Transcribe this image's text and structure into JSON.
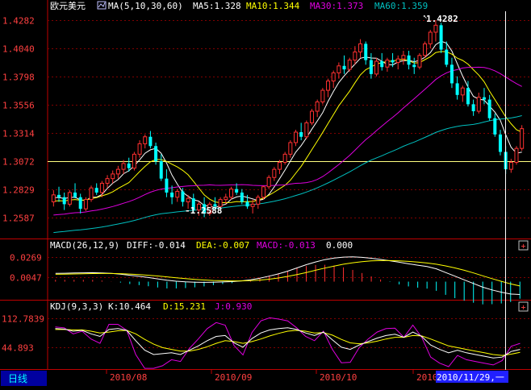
{
  "colors": {
    "background": "#000000",
    "frame": "#c00000",
    "grid": "#800000",
    "text_white": "#ffffff",
    "up_candle": "#ff3030",
    "down_candle": "#00ffff",
    "ma5": "#ffffff",
    "ma10": "#ffff00",
    "ma30": "#e000e0",
    "ma60": "#00c0c0",
    "diff": "#ffffff",
    "dea": "#ffff00",
    "macd_pos": "#ff3030",
    "macd_neg": "#00ffff",
    "k": "#ffffff",
    "d": "#ffff00",
    "j": "#e000e0",
    "axis_label": "#ff4040",
    "date_label": "#ff4040",
    "cursor_bg": "#2020ff",
    "period_tab_bg": "#0000a0",
    "period_tab_text": "#00ffff",
    "ref_line": "#ffff80"
  },
  "header": {
    "symbol": "欧元美元",
    "ma_params": "MA(5,10,30,60)",
    "ma5": "MA5:1.328",
    "ma10": "MA10:1.344",
    "ma30": "MA30:1.373",
    "ma60": "MA60:1.359"
  },
  "macd_header": {
    "params": "MACD(26,12,9)",
    "diff": "DIFF:-0.014",
    "dea": "DEA:-0.007",
    "macd": "MACD:-0.013",
    "zero": "0.000"
  },
  "kdj_header": {
    "params": "KDJ(9,3,3)",
    "k": "K:10.464",
    "d": "D:15.231",
    "j": "J:0.930"
  },
  "bottom": {
    "period_tab": "日线",
    "dates": [
      "2010/08",
      "2010/09",
      "2010/10",
      "2010"
    ],
    "cursor_date": "2010/11/29,一"
  },
  "annotations": {
    "high": "1.4282",
    "low": "1.2588"
  },
  "chart_data": [
    {
      "type": "candlestick",
      "panel": "price",
      "title": "欧元美元",
      "y_ticks": [
        1.4282,
        1.404,
        1.3798,
        1.3556,
        1.3314,
        1.3072,
        1.2829,
        1.2587
      ],
      "ylim": [
        1.246,
        1.436
      ],
      "reference_line": 1.3072,
      "ohlc": [
        [
          1.272,
          1.282,
          1.268,
          1.278
        ],
        [
          1.278,
          1.285,
          1.272,
          1.276
        ],
        [
          1.276,
          1.28,
          1.265,
          1.27
        ],
        [
          1.27,
          1.282,
          1.268,
          1.28
        ],
        [
          1.28,
          1.288,
          1.275,
          1.276
        ],
        [
          1.276,
          1.279,
          1.262,
          1.266
        ],
        [
          1.266,
          1.276,
          1.264,
          1.274
        ],
        [
          1.274,
          1.286,
          1.272,
          1.284
        ],
        [
          1.284,
          1.288,
          1.278,
          1.28
        ],
        [
          1.28,
          1.29,
          1.276,
          1.288
        ],
        [
          1.288,
          1.295,
          1.284,
          1.292
        ],
        [
          1.292,
          1.299,
          1.288,
          1.296
        ],
        [
          1.296,
          1.303,
          1.292,
          1.3
        ],
        [
          1.3,
          1.308,
          1.296,
          1.305
        ],
        [
          1.305,
          1.31,
          1.298,
          1.301
        ],
        [
          1.301,
          1.315,
          1.299,
          1.313
        ],
        [
          1.313,
          1.325,
          1.31,
          1.322
        ],
        [
          1.322,
          1.33,
          1.318,
          1.328
        ],
        [
          1.328,
          1.333,
          1.318,
          1.32
        ],
        [
          1.32,
          1.323,
          1.304,
          1.307
        ],
        [
          1.307,
          1.313,
          1.29,
          1.292
        ],
        [
          1.292,
          1.3,
          1.276,
          1.28
        ],
        [
          1.28,
          1.286,
          1.27,
          1.276
        ],
        [
          1.276,
          1.283,
          1.272,
          1.281
        ],
        [
          1.281,
          1.284,
          1.268,
          1.272
        ],
        [
          1.272,
          1.278,
          1.266,
          1.275
        ],
        [
          1.275,
          1.279,
          1.262,
          1.265
        ],
        [
          1.265,
          1.272,
          1.26,
          1.27
        ],
        [
          1.27,
          1.276,
          1.2588,
          1.262
        ],
        [
          1.262,
          1.272,
          1.26,
          1.27
        ],
        [
          1.27,
          1.276,
          1.266,
          1.268
        ],
        [
          1.268,
          1.276,
          1.265,
          1.274
        ],
        [
          1.274,
          1.279,
          1.27,
          1.276
        ],
        [
          1.276,
          1.285,
          1.274,
          1.283
        ],
        [
          1.283,
          1.288,
          1.278,
          1.28
        ],
        [
          1.28,
          1.283,
          1.27,
          1.272
        ],
        [
          1.272,
          1.278,
          1.266,
          1.268
        ],
        [
          1.268,
          1.274,
          1.262,
          1.27
        ],
        [
          1.27,
          1.278,
          1.266,
          1.276
        ],
        [
          1.276,
          1.286,
          1.274,
          1.285
        ],
        [
          1.285,
          1.295,
          1.283,
          1.293
        ],
        [
          1.293,
          1.302,
          1.29,
          1.3
        ],
        [
          1.3,
          1.308,
          1.296,
          1.306
        ],
        [
          1.306,
          1.315,
          1.304,
          1.313
        ],
        [
          1.313,
          1.325,
          1.31,
          1.323
        ],
        [
          1.323,
          1.334,
          1.32,
          1.332
        ],
        [
          1.332,
          1.34,
          1.325,
          1.328
        ],
        [
          1.328,
          1.342,
          1.326,
          1.34
        ],
        [
          1.34,
          1.352,
          1.338,
          1.35
        ],
        [
          1.35,
          1.36,
          1.345,
          1.358
        ],
        [
          1.358,
          1.37,
          1.356,
          1.368
        ],
        [
          1.368,
          1.378,
          1.362,
          1.376
        ],
        [
          1.376,
          1.385,
          1.37,
          1.383
        ],
        [
          1.383,
          1.392,
          1.378,
          1.389
        ],
        [
          1.389,
          1.398,
          1.382,
          1.386
        ],
        [
          1.386,
          1.396,
          1.384,
          1.394
        ],
        [
          1.394,
          1.406,
          1.39,
          1.401
        ],
        [
          1.401,
          1.412,
          1.396,
          1.408
        ],
        [
          1.408,
          1.41,
          1.39,
          1.394
        ],
        [
          1.394,
          1.4,
          1.378,
          1.382
        ],
        [
          1.382,
          1.396,
          1.38,
          1.393
        ],
        [
          1.393,
          1.4,
          1.385,
          1.388
        ],
        [
          1.388,
          1.396,
          1.384,
          1.394
        ],
        [
          1.394,
          1.4,
          1.388,
          1.392
        ],
        [
          1.392,
          1.398,
          1.386,
          1.395
        ],
        [
          1.395,
          1.402,
          1.39,
          1.398
        ],
        [
          1.398,
          1.402,
          1.386,
          1.39
        ],
        [
          1.39,
          1.396,
          1.382,
          1.388
        ],
        [
          1.388,
          1.4,
          1.386,
          1.398
        ],
        [
          1.398,
          1.41,
          1.396,
          1.408
        ],
        [
          1.408,
          1.42,
          1.404,
          1.418
        ],
        [
          1.418,
          1.4282,
          1.41,
          1.424
        ],
        [
          1.424,
          1.426,
          1.4,
          1.403
        ],
        [
          1.403,
          1.41,
          1.388,
          1.39
        ],
        [
          1.39,
          1.396,
          1.37,
          1.374
        ],
        [
          1.374,
          1.38,
          1.36,
          1.364
        ],
        [
          1.364,
          1.372,
          1.358,
          1.37
        ],
        [
          1.37,
          1.376,
          1.354,
          1.356
        ],
        [
          1.356,
          1.36,
          1.346,
          1.35
        ],
        [
          1.35,
          1.366,
          1.348,
          1.362
        ],
        [
          1.362,
          1.37,
          1.356,
          1.36
        ],
        [
          1.36,
          1.364,
          1.342,
          1.344
        ],
        [
          1.344,
          1.348,
          1.328,
          1.33
        ],
        [
          1.33,
          1.334,
          1.312,
          1.315
        ],
        [
          1.315,
          1.32,
          1.296,
          1.3
        ],
        [
          1.3,
          1.309,
          1.297,
          1.306
        ],
        [
          1.306,
          1.32,
          1.304,
          1.318
        ],
        [
          1.318,
          1.338,
          1.316,
          1.335
        ]
      ]
    },
    {
      "type": "line",
      "panel": "macd",
      "title": "MACD(26,12,9)",
      "y_ticks": [
        0.0269,
        0.0047
      ],
      "ylim": [
        -0.018,
        0.033
      ],
      "series": [
        {
          "name": "DIFF",
          "values": [
            0.009,
            0.0092,
            0.0094,
            0.0096,
            0.0098,
            0.0095,
            0.009,
            0.0082,
            0.007,
            0.0058,
            0.0045,
            0.003,
            0.0015,
            0.0005,
            -0.0002,
            -0.0006,
            -0.0008,
            -0.0006,
            -0.0003,
            0.0,
            0.0008,
            0.002,
            0.0038,
            0.006,
            0.0085,
            0.0115,
            0.015,
            0.0185,
            0.0215,
            0.024,
            0.0258,
            0.0268,
            0.027,
            0.0265,
            0.0255,
            0.0242,
            0.0228,
            0.0212,
            0.0195,
            0.018,
            0.0165,
            0.014,
            0.01,
            0.006,
            0.002,
            -0.002,
            -0.006,
            -0.009,
            -0.0115,
            -0.0135,
            -0.014
          ]
        },
        {
          "name": "DEA",
          "values": [
            0.008,
            0.0082,
            0.0084,
            0.0086,
            0.0088,
            0.0089,
            0.0089,
            0.0087,
            0.0083,
            0.0077,
            0.007,
            0.0062,
            0.0052,
            0.0042,
            0.0033,
            0.0025,
            0.0018,
            0.0013,
            0.001,
            0.0008,
            0.0008,
            0.0011,
            0.0017,
            0.0027,
            0.004,
            0.0057,
            0.0077,
            0.01,
            0.0124,
            0.0148,
            0.017,
            0.019,
            0.0206,
            0.0218,
            0.0226,
            0.023,
            0.023,
            0.0227,
            0.0221,
            0.0213,
            0.0203,
            0.019,
            0.0172,
            0.015,
            0.0124,
            0.0095,
            0.0064,
            0.0033,
            0.0004,
            -0.0024,
            -0.0047
          ]
        },
        {
          "name": "MACD",
          "values": [
            0.002,
            0.002,
            0.002,
            0.002,
            0.002,
            0.0012,
            0.0002,
            -0.001,
            -0.0026,
            -0.0038,
            -0.005,
            -0.0064,
            -0.0074,
            -0.0074,
            -0.007,
            -0.0062,
            -0.0052,
            -0.0038,
            -0.0026,
            -0.0016,
            0.0,
            0.0018,
            0.0042,
            0.0066,
            0.009,
            0.0116,
            0.0146,
            0.017,
            0.0182,
            0.0184,
            0.0176,
            0.0156,
            0.0128,
            0.0094,
            0.0058,
            0.0024,
            -0.0004,
            -0.003,
            -0.0052,
            -0.0066,
            -0.0076,
            -0.01,
            -0.0144,
            -0.018,
            -0.0208,
            -0.023,
            -0.0248,
            -0.0246,
            -0.0238,
            -0.0222,
            -0.0186
          ]
        }
      ]
    },
    {
      "type": "line",
      "panel": "kdj",
      "title": "KDJ(9,3,3)",
      "y_ticks": [
        112.7839,
        44.893
      ],
      "ylim": [
        0,
        125
      ],
      "series": [
        {
          "name": "K",
          "values": [
            88,
            87,
            82,
            84,
            76,
            70,
            86,
            88,
            84,
            60,
            38,
            28,
            30,
            32,
            28,
            38,
            48,
            60,
            70,
            72,
            55,
            45,
            65,
            78,
            85,
            88,
            90,
            86,
            78,
            72,
            80,
            62,
            45,
            40,
            50,
            58,
            66,
            72,
            75,
            68,
            80,
            70,
            50,
            40,
            32,
            38,
            32,
            28,
            24,
            20,
            22,
            35,
            40
          ]
        },
        {
          "name": "D",
          "values": [
            86,
            86,
            85,
            85,
            82,
            78,
            80,
            83,
            84,
            76,
            63,
            52,
            44,
            40,
            36,
            36,
            40,
            46,
            54,
            60,
            58,
            54,
            58,
            64,
            71,
            77,
            82,
            84,
            82,
            78,
            79,
            73,
            63,
            55,
            53,
            55,
            59,
            64,
            68,
            68,
            72,
            71,
            64,
            56,
            48,
            44,
            40,
            36,
            32,
            28,
            26,
            29,
            33
          ]
        },
        {
          "name": "J",
          "values": [
            92,
            90,
            76,
            82,
            64,
            54,
            98,
            98,
            84,
            28,
            -12,
            -20,
            2,
            16,
            12,
            42,
            64,
            88,
            102,
            96,
            49,
            27,
            79,
            106,
            113,
            110,
            106,
            90,
            70,
            60,
            82,
            40,
            9,
            10,
            44,
            64,
            80,
            88,
            89,
            68,
            96,
            68,
            22,
            8,
            0,
            26,
            16,
            12,
            8,
            4,
            14,
            47,
            54
          ]
        }
      ]
    }
  ]
}
